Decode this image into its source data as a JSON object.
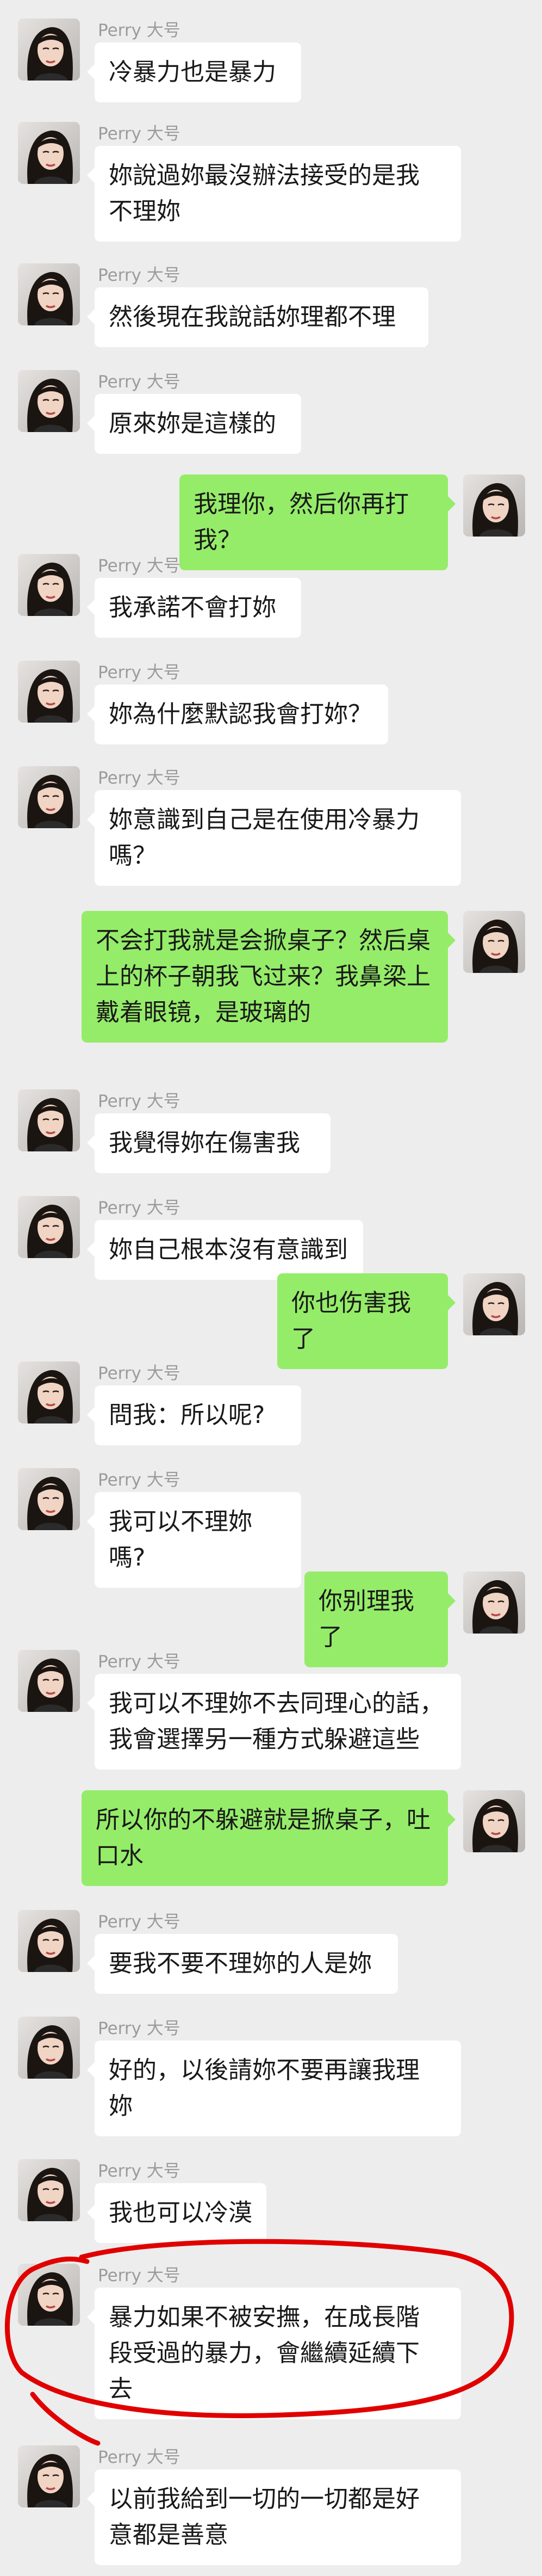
{
  "sender_name": "Perry 大号",
  "colors": {
    "background": "#ededed",
    "incoming_bubble": "#ffffff",
    "outgoing_bubble": "#95ec69",
    "sender_text": "#9b9b9b",
    "annotation_ink": "#e00000"
  },
  "messages": [
    {
      "side": "left",
      "text": "冷暴力也是暴力"
    },
    {
      "side": "left",
      "text": "妳說過妳最沒辦法接受的是我\n不理妳"
    },
    {
      "side": "left",
      "text": "然後現在我說話妳理都不理"
    },
    {
      "side": "left",
      "text": "原來妳是這樣的"
    },
    {
      "side": "right",
      "text": "我理你，然后你再打我？"
    },
    {
      "side": "left",
      "text": "我承諾不會打妳"
    },
    {
      "side": "left",
      "text": "妳為什麼默認我會打妳？"
    },
    {
      "side": "left",
      "text": "妳意識到自己是在使用冷暴力\n嗎？"
    },
    {
      "side": "right",
      "text": "不会打我就是会掀桌子？然后桌\n上的杯子朝我飞过来？我鼻梁上\n戴着眼镜，是玻璃的"
    },
    {
      "side": "left",
      "text": "我覺得妳在傷害我"
    },
    {
      "side": "left",
      "text": "妳自己根本沒有意識到"
    },
    {
      "side": "right",
      "text": "你也伤害我了"
    },
    {
      "side": "left",
      "text": "問我：所以呢?"
    },
    {
      "side": "left",
      "text": "我可以不理妳嗎?"
    },
    {
      "side": "right",
      "text": "你别理我了"
    },
    {
      "side": "left",
      "text": "我可以不理妳不去同理心的話，\n我會選擇另一種方式躲避這些"
    },
    {
      "side": "right",
      "text": "所以你的不躲避就是掀桌子，吐\n口水"
    },
    {
      "side": "left",
      "text": "要我不要不理妳的人是妳"
    },
    {
      "side": "left",
      "text": "好的，以後請妳不要再讓我理\n妳"
    },
    {
      "side": "left",
      "text": "我也可以冷漠"
    },
    {
      "side": "left",
      "text": "暴力如果不被安撫，在成長階\n段受過的暴力，會繼續延續下\n去"
    },
    {
      "side": "left",
      "text": "以前我給到一切的一切都是好\n意都是善意"
    }
  ]
}
